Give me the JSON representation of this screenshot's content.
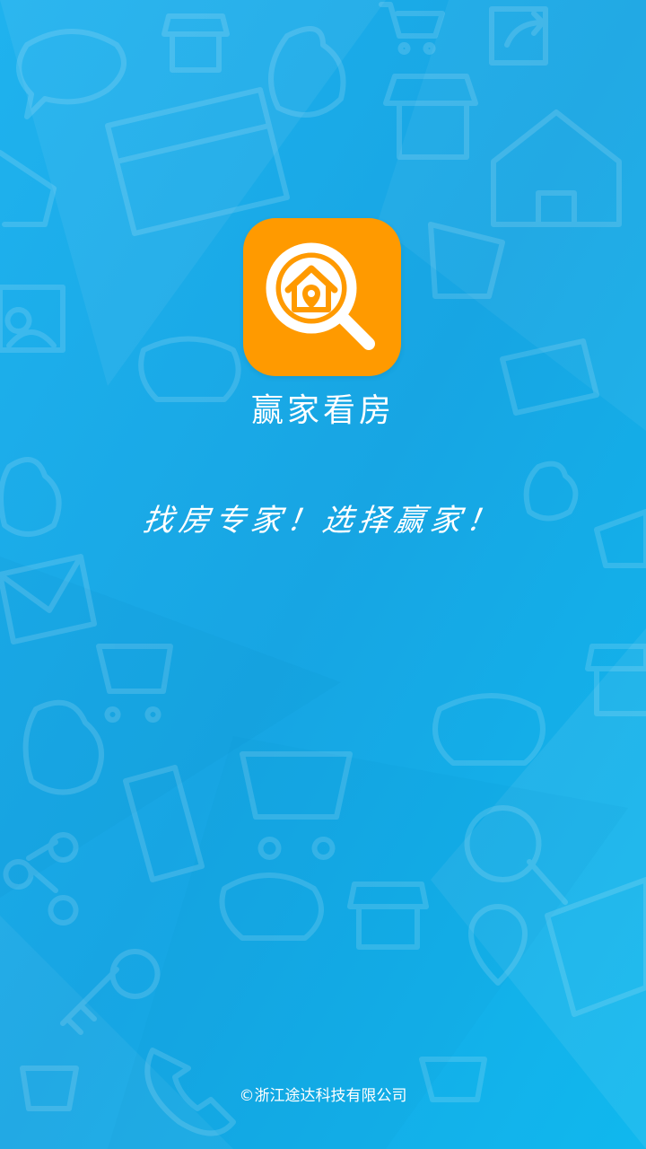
{
  "app": {
    "name": "赢家看房",
    "slogan": "找房专家！选择赢家！",
    "copyright": "©浙江途达科技有限公司"
  },
  "colors": {
    "background": "#1aa9e6",
    "icon_background": "#ff9a00",
    "text": "#ffffff"
  },
  "background_icons": [
    "chat-bubble-icon",
    "storefront-icon",
    "shopping-cart-icon",
    "money-bag-icon",
    "share-arrow-icon",
    "house-icon",
    "credit-card-icon",
    "piggy-bank-icon",
    "photo-icon",
    "envelope-icon",
    "smartphone-icon",
    "share-nodes-icon",
    "key-icon",
    "magnifier-icon",
    "location-pin-icon",
    "phone-icon",
    "yen-coin-icon"
  ]
}
